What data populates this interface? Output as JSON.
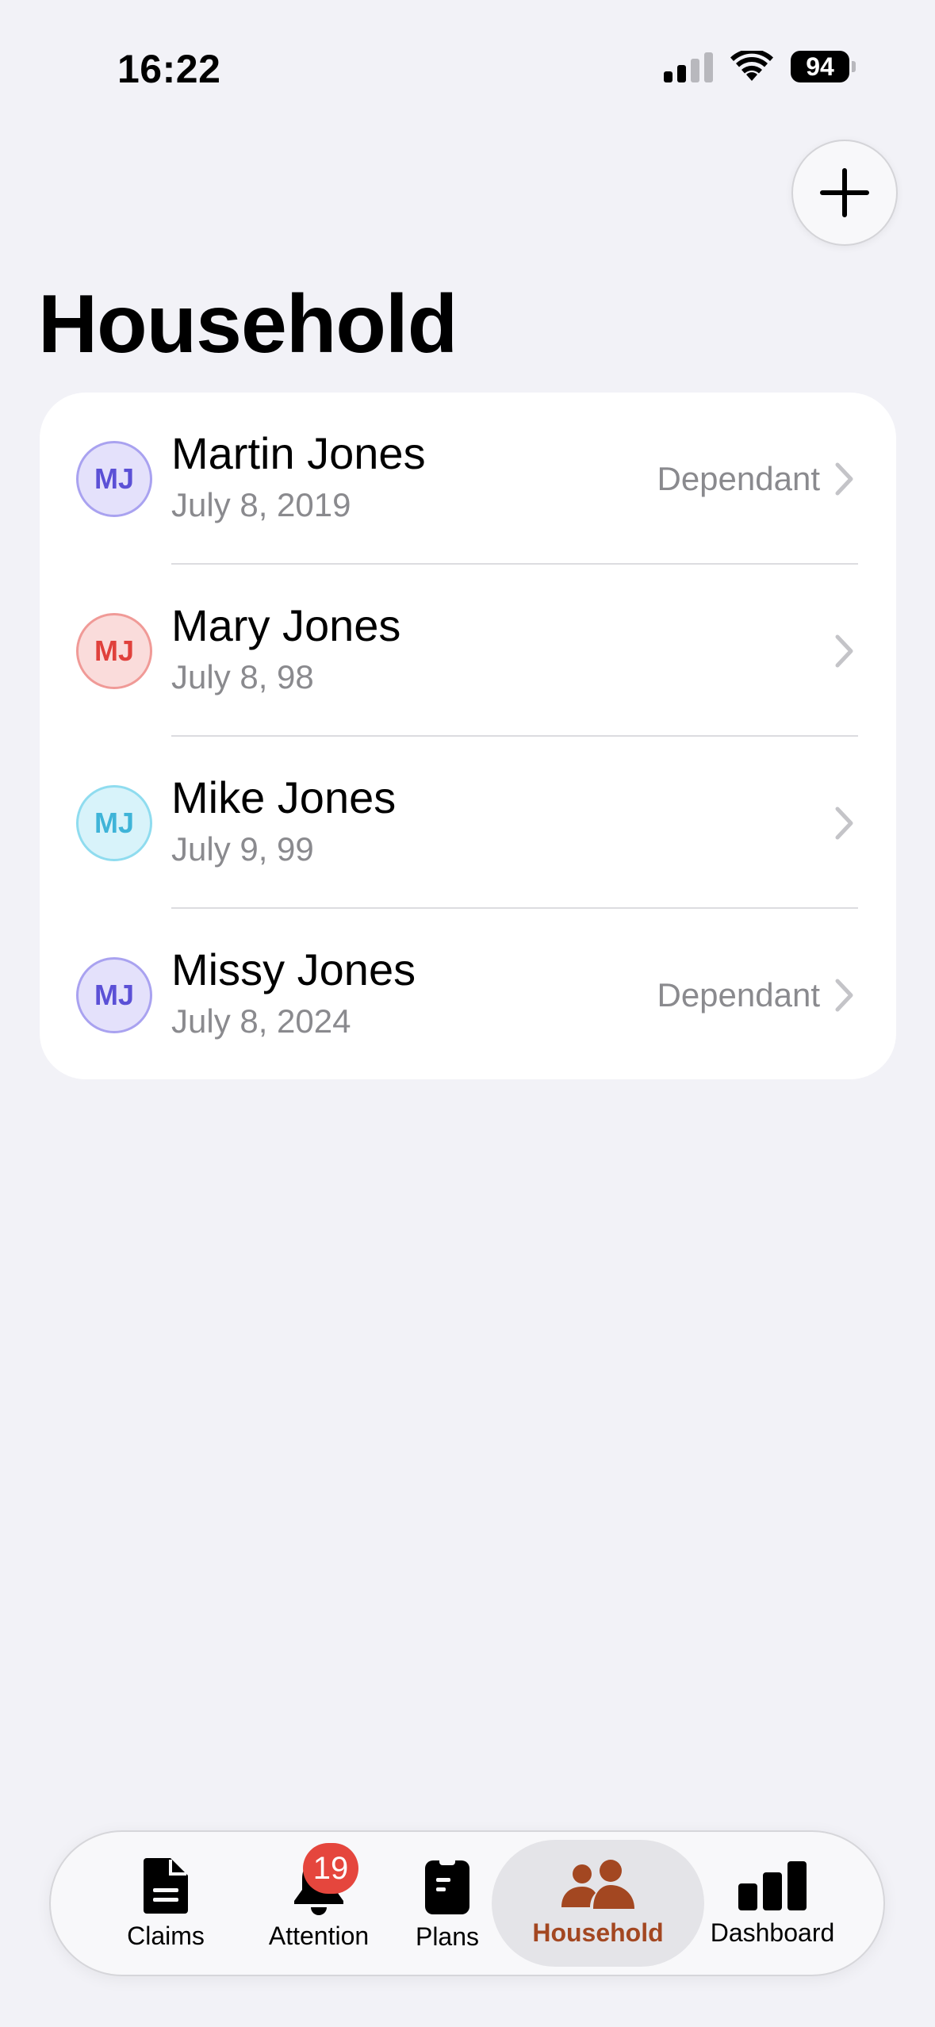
{
  "status_bar": {
    "time": "16:22",
    "battery": "94"
  },
  "header": {
    "title": "Household"
  },
  "members": [
    {
      "initials": "MJ",
      "name": "Martin Jones",
      "dob": "July 8, 2019",
      "role": "Dependant",
      "color": "#5b50d6",
      "bg": "#e4e1fb",
      "border": "#a9a2f0"
    },
    {
      "initials": "MJ",
      "name": "Mary Jones",
      "dob": "July 8, 98",
      "role": "",
      "color": "#e0413c",
      "bg": "#fadcdb",
      "border": "#f09a97"
    },
    {
      "initials": "MJ",
      "name": "Mike Jones",
      "dob": "July 9, 99",
      "role": "",
      "color": "#3fb4d8",
      "bg": "#d8f3fa",
      "border": "#8fdcef"
    },
    {
      "initials": "MJ",
      "name": "Missy Jones",
      "dob": "July 8, 2024",
      "role": "Dependant",
      "color": "#5b50d6",
      "bg": "#e4e1fb",
      "border": "#a9a2f0"
    }
  ],
  "tabbar": {
    "tabs": [
      {
        "label": "Claims",
        "icon": "document-icon"
      },
      {
        "label": "Attention",
        "icon": "bell-icon",
        "badge": "19"
      },
      {
        "label": "Plans",
        "icon": "clipboard-icon"
      },
      {
        "label": "Household",
        "icon": "people-icon",
        "active": true
      },
      {
        "label": "Dashboard",
        "icon": "bar-chart-icon"
      }
    ],
    "active_color": "#a34721"
  }
}
